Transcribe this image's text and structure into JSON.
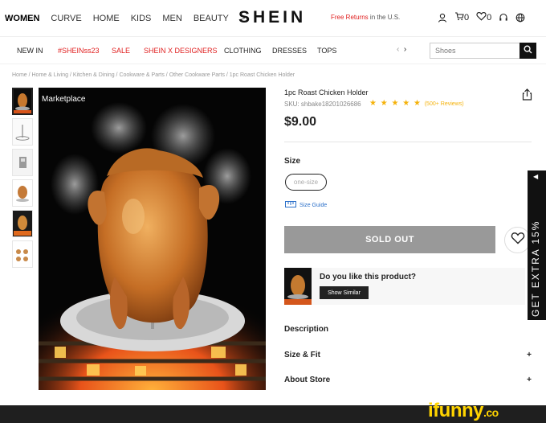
{
  "header": {
    "categories": [
      "WOMEN",
      "CURVE",
      "HOME",
      "KIDS",
      "MEN",
      "BEAUTY"
    ],
    "more_glyph": ">",
    "logo": "SHEIN",
    "free_returns": "Free Returns",
    "free_returns_rest": " in the U.S.",
    "cart_count": "0",
    "wishlist_count": "0"
  },
  "nav": {
    "items": [
      "NEW IN",
      "#SHEINss23",
      "SALE",
      "SHEIN X DESIGNERS",
      "CLOTHING",
      "DRESSES",
      "TOPS"
    ],
    "search_value": "Shoes"
  },
  "breadcrumb": "Home / Home & Living / Kitchen & Dining / Cookware & Parts / Other Cookware Parts / 1pc Roast Chicken Holder",
  "product": {
    "marketplace_label": "Marketplace",
    "title": "1pc Roast Chicken Holder",
    "sku": "SKU: shbake18201026686",
    "stars": "★ ★ ★ ★ ★",
    "rating": 5,
    "reviews": "(500+ Reviews)",
    "price": "$9.00",
    "size_label": "Size",
    "size_option": "one-size",
    "size_guide": "Size Guide",
    "sold_out": "SOLD OUT",
    "similar_question": "Do you like this product?",
    "show_similar": "Show Similar",
    "sections": [
      {
        "label": "Description",
        "icon": ""
      },
      {
        "label": "Size & Fit",
        "icon": "+"
      },
      {
        "label": "About Store",
        "icon": "+"
      }
    ]
  },
  "promo": {
    "text": "GET EXTRA 15%",
    "arrow": "◀"
  },
  "watermark": {
    "main": "ifunny",
    "suffix": ".co"
  },
  "colors": {
    "accent_red": "#e02020",
    "star": "#f5b20a",
    "link_blue": "#2a6fc9",
    "sold_out_bg": "#999999",
    "watermark": "#ffd400"
  },
  "icons": [
    "user-icon",
    "cart-icon",
    "heart-icon",
    "headset-icon",
    "globe-icon",
    "search-icon",
    "share-icon",
    "ruler-icon",
    "wishlist-heart-icon"
  ]
}
